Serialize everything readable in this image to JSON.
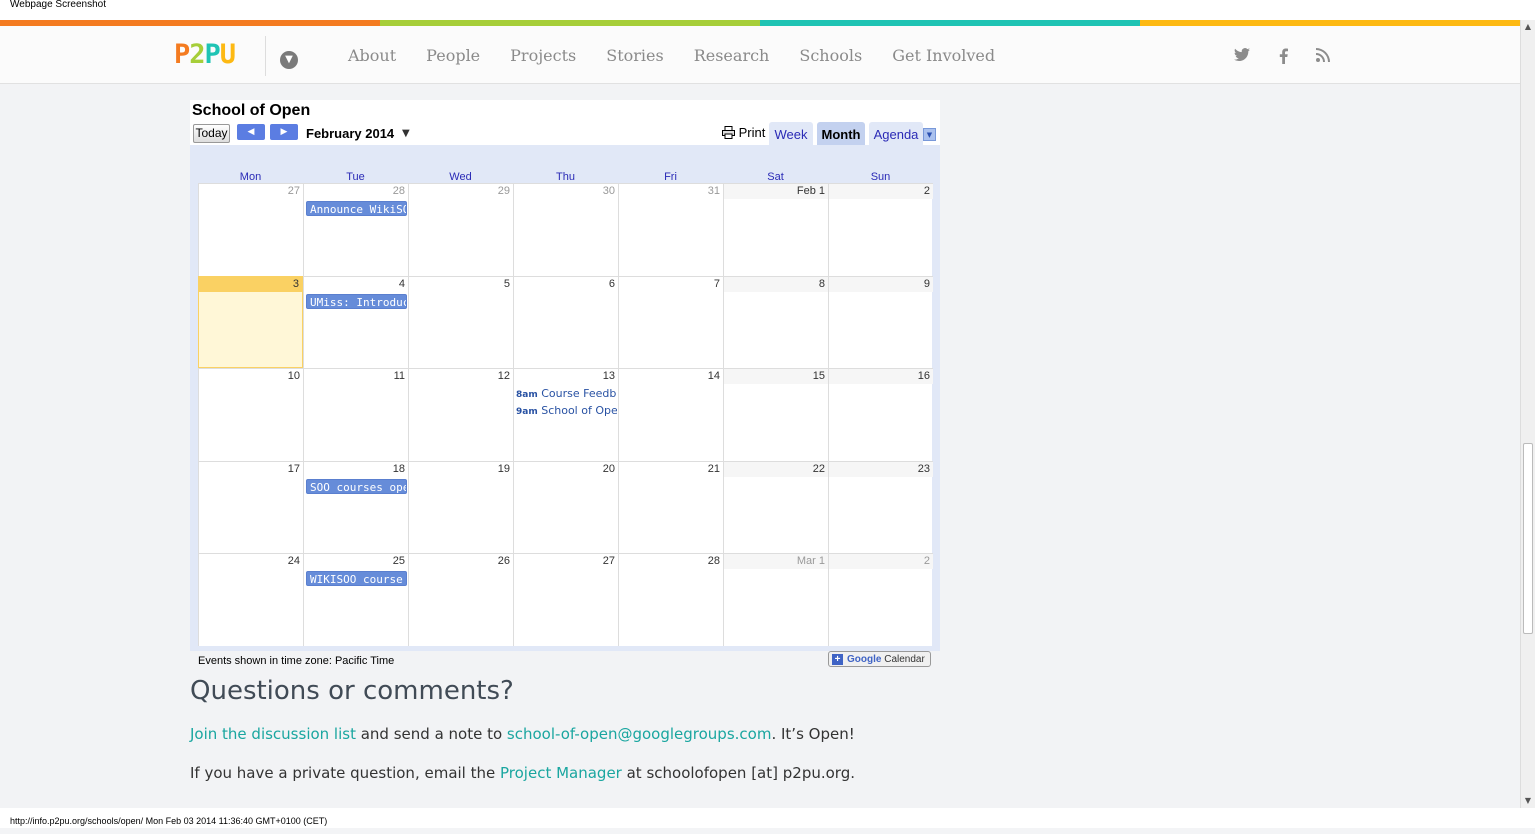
{
  "screenshot_title": "Webpage Screenshot",
  "status_bar": "http://info.p2pu.org/schools/open/ Mon Feb 03 2014 11:36:40 GMT+0100 (CET)",
  "colors": {
    "bar_orange": "#f47b20",
    "bar_green": "#a6ce39",
    "bar_teal": "#1fc4b4",
    "bar_yellow": "#fdb913",
    "link": "#1aa6a0",
    "event": "#668cd9",
    "today": "#fad163"
  },
  "nav": {
    "logo": {
      "p1": "P",
      "two": "2",
      "p2": "P",
      "u": "U"
    },
    "dropdown_icon": "chevron-down-icon",
    "links": [
      "About",
      "People",
      "Projects",
      "Stories",
      "Research",
      "Schools",
      "Get Involved"
    ],
    "social_icons": [
      "twitter-icon",
      "facebook-icon",
      "rss-icon"
    ]
  },
  "calendar": {
    "title": "School of Open",
    "today_label": "Today",
    "prev_icon": "◀",
    "next_icon": "▶",
    "month_label": "February 2014",
    "print_label": "Print",
    "tabs": [
      "Week",
      "Month",
      "Agenda"
    ],
    "active_tab": "Month",
    "day_headers": [
      "Mon",
      "Tue",
      "Wed",
      "Thu",
      "Fri",
      "Sat",
      "Sun"
    ],
    "weeks": [
      {
        "days": [
          "27",
          "28",
          "29",
          "30",
          "31",
          "Feb 1",
          "2"
        ],
        "dim": [
          true,
          true,
          true,
          true,
          true,
          false,
          false
        ]
      },
      {
        "days": [
          "3",
          "4",
          "5",
          "6",
          "7",
          "8",
          "9"
        ],
        "dim": [
          false,
          false,
          false,
          false,
          false,
          false,
          false
        ]
      },
      {
        "days": [
          "10",
          "11",
          "12",
          "13",
          "14",
          "15",
          "16"
        ],
        "dim": [
          false,
          false,
          false,
          false,
          false,
          false,
          false
        ]
      },
      {
        "days": [
          "17",
          "18",
          "19",
          "20",
          "21",
          "22",
          "23"
        ],
        "dim": [
          false,
          false,
          false,
          false,
          false,
          false,
          false
        ]
      },
      {
        "days": [
          "24",
          "25",
          "26",
          "27",
          "28",
          "Mar 1",
          "2"
        ],
        "dim": [
          false,
          false,
          false,
          false,
          false,
          true,
          true
        ]
      }
    ],
    "events": {
      "w0_tue": "Announce WikiSOO",
      "w1_tue": "UMiss: Introduction",
      "w2_thu_1_time": "8am",
      "w2_thu_1_title": "Course Feedback",
      "w2_thu_2_time": "9am",
      "w2_thu_2_title": "School of Open",
      "w3_tue": "SOO courses open",
      "w4_tue": "WIKISOO course"
    },
    "timezone_note": "Events shown in time zone: Pacific Time",
    "gcal_button": {
      "google": "Google",
      "calendar": "Calendar"
    }
  },
  "questions": {
    "heading": "Questions or comments?",
    "line1_link1": "Join the discussion list",
    "line1_text1": " and send a note to ",
    "line1_link2": "school-of-open@googlegroups.com",
    "line1_text2": ". It’s Open!",
    "line2_text1": "If you have a private question, email the ",
    "line2_link": "Project Manager",
    "line2_text2": " at schoolofopen [at] p2pu.org."
  }
}
